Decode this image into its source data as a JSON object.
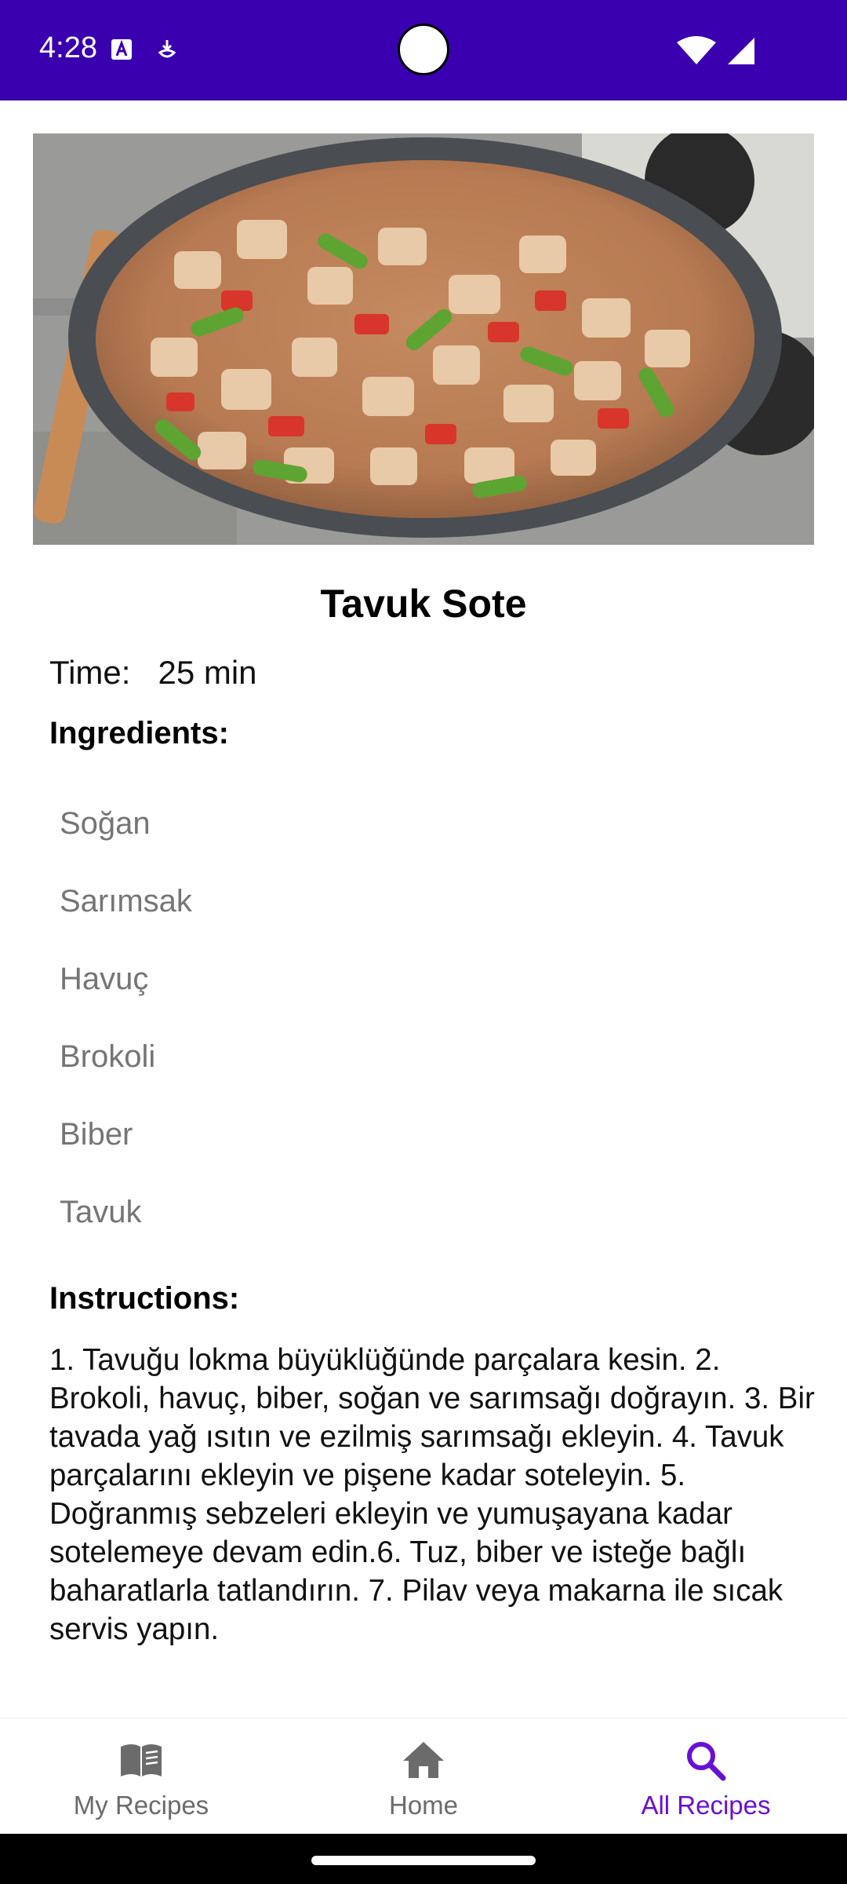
{
  "status_bar": {
    "time": "4:28",
    "icons": [
      "text-format-icon",
      "download-icon",
      "wifi-icon",
      "cellular-signal-icon"
    ],
    "background": "#3a00b0"
  },
  "recipe": {
    "image_alt": "Tavuk Sote",
    "title": "Tavuk Sote",
    "time_label": "Time:",
    "time_value": "25 min",
    "ingredients_heading": "Ingredients:",
    "ingredients": [
      "Soğan",
      "Sarımsak",
      "Havuç",
      "Brokoli",
      "Biber",
      "Tavuk"
    ],
    "instructions_heading": "Instructions:",
    "instructions": "1. Tavuğu lokma büyüklüğünde parçalara kesin. 2. Brokoli, havuç, biber, soğan ve sarımsağı doğrayın. 3. Bir tavada yağ ısıtın ve ezilmiş sarımsağı ekleyin. 4. Tavuk parçalarını ekleyin ve pişene kadar soteleyin. 5. Doğranmış sebzeleri ekleyin ve yumuşayana kadar sotelemeye devam edin.6. Tuz, biber ve isteğe bağlı baharatlarla tatlandırın. 7. Pilav veya makarna ile sıcak servis yapın."
  },
  "bottom_nav": {
    "items": [
      {
        "label": "My Recipes",
        "icon": "book-icon",
        "active": false
      },
      {
        "label": "Home",
        "icon": "home-icon",
        "active": false
      },
      {
        "label": "All Recipes",
        "icon": "search-icon",
        "active": true
      }
    ],
    "active_color": "#6a10d6",
    "inactive_color": "#6b6b6b"
  }
}
